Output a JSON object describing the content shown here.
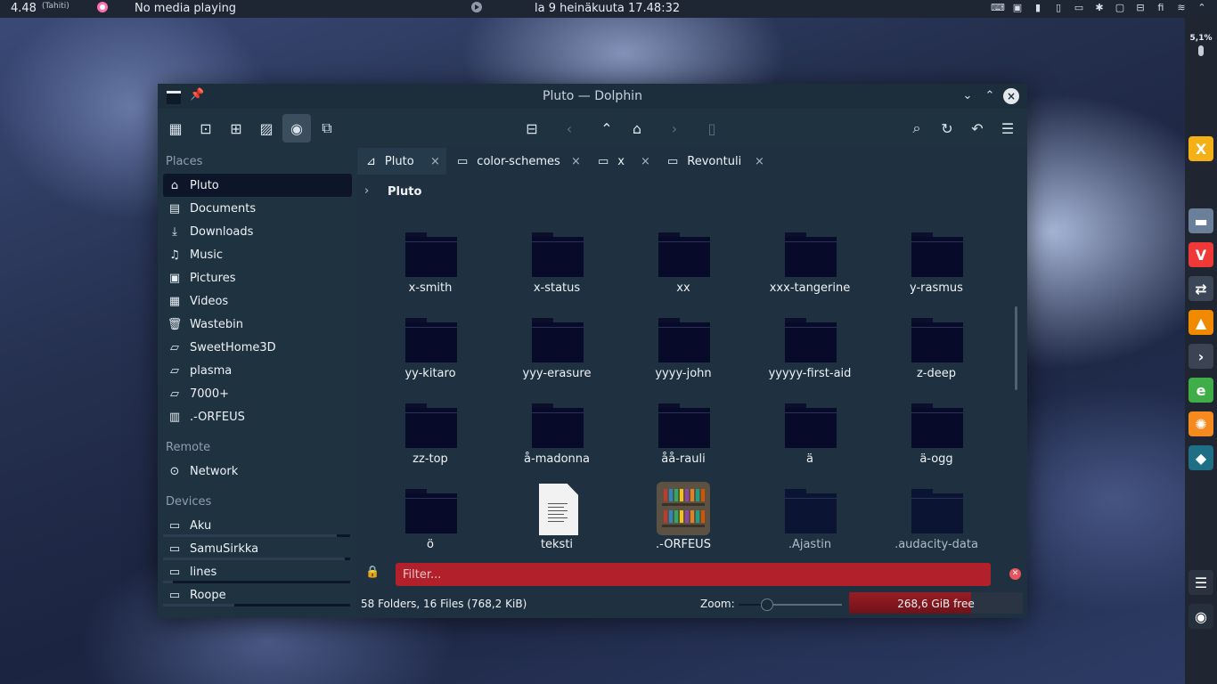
{
  "top_panel": {
    "time_small": "4.48",
    "timezone": "(Tahiti)",
    "media": "No media playing",
    "datetime": "la 9 heinäkuuta 17.48:32",
    "tray_icons": [
      "keyboard-layout-icon",
      "clipboard-icon",
      "battery-icon",
      "kdeconnect-icon",
      "display-icon",
      "bluetooth-icon",
      "lock-icon",
      "power-icon",
      "finnish-input-icon",
      "wifi-icon",
      "expand-tray-icon"
    ],
    "tray_glyphs": [
      "⌨",
      "▣",
      "▮",
      "▯",
      "▭",
      "✱",
      "▢",
      "⊟",
      "fi",
      "≋",
      "⌃"
    ]
  },
  "dock": {
    "cpu_label": "5,1%",
    "apps": [
      {
        "name": "x-app",
        "glyph": "X",
        "color": "#f5b015"
      },
      {
        "name": "dolphin",
        "glyph": "▬",
        "color": "#6a7f9a"
      },
      {
        "name": "vivaldi",
        "glyph": "V",
        "color": "#ef3939"
      },
      {
        "name": "mixer",
        "glyph": "⇄",
        "color": "#3b4656"
      },
      {
        "name": "vlc",
        "glyph": "▲",
        "color": "#f08a00"
      },
      {
        "name": "konsole",
        "glyph": "›",
        "color": "#3a4452"
      },
      {
        "name": "kde-e",
        "glyph": "e",
        "color": "#3fae49"
      },
      {
        "name": "orange",
        "glyph": "✺",
        "color": "#f58a1f"
      },
      {
        "name": "krita",
        "glyph": "◆",
        "color": "#1e6f86"
      },
      {
        "name": "notes",
        "glyph": "☰",
        "color": "#2b3340"
      },
      {
        "name": "clock",
        "glyph": "◉",
        "color": "#25303c"
      }
    ]
  },
  "window": {
    "title": "Pluto — Dolphin",
    "places_title": "Places",
    "places": [
      {
        "label": "Pluto",
        "icon": "home-icon",
        "glyph": "⌂"
      },
      {
        "label": "Documents",
        "icon": "documents-icon",
        "glyph": "▤"
      },
      {
        "label": "Downloads",
        "icon": "download-icon",
        "glyph": "⤓"
      },
      {
        "label": "Music",
        "icon": "music-icon",
        "glyph": "♫"
      },
      {
        "label": "Pictures",
        "icon": "pictures-icon",
        "glyph": "▣"
      },
      {
        "label": "Videos",
        "icon": "videos-icon",
        "glyph": "▦"
      },
      {
        "label": "Wastebin",
        "icon": "trash-icon",
        "glyph": "🗑"
      },
      {
        "label": "SweetHome3D",
        "icon": "folder-icon",
        "glyph": "▱"
      },
      {
        "label": "plasma",
        "icon": "folder-icon",
        "glyph": "▱"
      },
      {
        "label": "7000+",
        "icon": "folder-icon",
        "glyph": "▱"
      },
      {
        "label": ".-ORFEUS",
        "icon": "books-icon",
        "glyph": "▥"
      }
    ],
    "remote_title": "Remote",
    "network_label": "Network",
    "devices_title": "Devices",
    "devices": [
      {
        "label": "Aku",
        "usage": 0.93
      },
      {
        "label": "SamuSirkka",
        "usage": 0.97
      },
      {
        "label": "lines",
        "usage": 0.05
      },
      {
        "label": "Roope",
        "usage": 0.38
      }
    ],
    "tabs": [
      {
        "label": "Pluto",
        "icon": "⊿"
      },
      {
        "label": "color-schemes",
        "icon": "▭"
      },
      {
        "label": "x",
        "icon": "▭"
      },
      {
        "label": "Revontuli",
        "icon": "▭"
      }
    ],
    "tab_close_glyph": "×",
    "breadcrumb": "Pluto",
    "files": [
      {
        "name": "x-smith",
        "type": "folder"
      },
      {
        "name": "x-status",
        "type": "folder"
      },
      {
        "name": "xx",
        "type": "folder"
      },
      {
        "name": "xxx-tangerine",
        "type": "folder"
      },
      {
        "name": "y-rasmus",
        "type": "folder"
      },
      {
        "name": "yy-kitaro",
        "type": "folder"
      },
      {
        "name": "yyy-erasure",
        "type": "folder"
      },
      {
        "name": "yyyy-john",
        "type": "folder"
      },
      {
        "name": "yyyyy-first-aid",
        "type": "folder"
      },
      {
        "name": "z-deep",
        "type": "folder"
      },
      {
        "name": "zz-top",
        "type": "folder"
      },
      {
        "name": "å-madonna",
        "type": "folder"
      },
      {
        "name": "åå-rauli",
        "type": "folder"
      },
      {
        "name": "ä",
        "type": "folder"
      },
      {
        "name": "ä-ogg",
        "type": "folder"
      },
      {
        "name": "ö",
        "type": "folder"
      },
      {
        "name": "teksti",
        "type": "text"
      },
      {
        "name": ".-ORFEUS",
        "type": "books"
      },
      {
        "name": ".Ajastin",
        "type": "hidden"
      },
      {
        "name": ".audacity-data",
        "type": "hidden"
      }
    ],
    "filter_placeholder": "Filter...",
    "status": "58 Folders, 16 Files (768,2 KiB)",
    "zoom_label": "Zoom:",
    "zoom_level": 0.27,
    "free_space": "268,6 GiB free",
    "disk_used": 0.7
  }
}
